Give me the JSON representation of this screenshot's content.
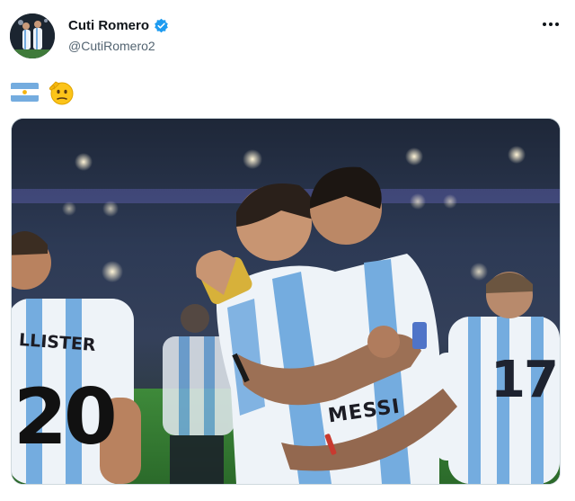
{
  "tweet": {
    "author": {
      "display_name": "Cuti Romero",
      "handle": "@CutiRomero2",
      "verified": true
    },
    "body_emojis": [
      "argentina-flag",
      "saluting-face"
    ],
    "more_icon": "more-horizontal-icon",
    "media": {
      "jersey_texts": {
        "center_name": "MESSI",
        "left_name": "LLISTER",
        "left_number": "20",
        "right_number": "17"
      }
    }
  },
  "colors": {
    "verified_blue": "#1d9bf0",
    "argentina_light_blue": "#74acdf",
    "argentina_sun": "#f6b40e"
  }
}
